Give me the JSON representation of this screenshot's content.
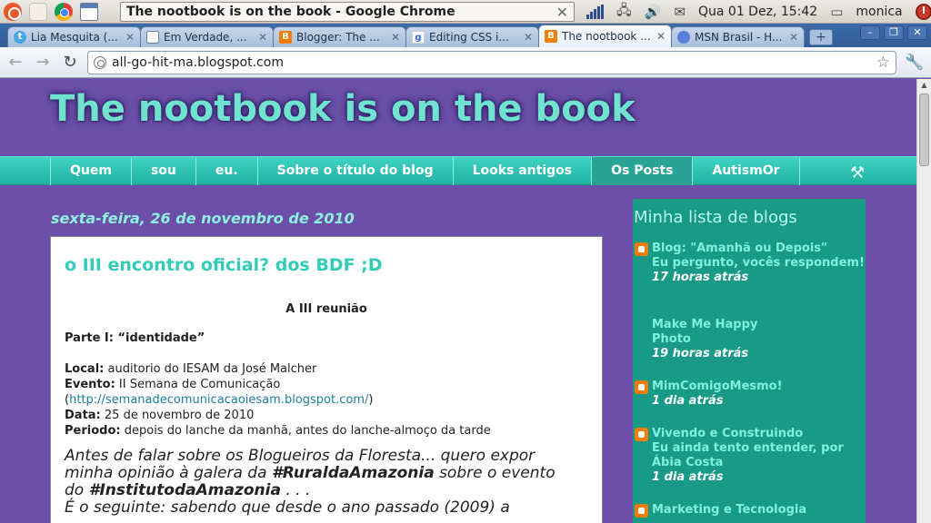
{
  "panel": {
    "window_title": "The nootbook is on the book - Google Chrome",
    "clock": "Qua 01 Dez, 15:42",
    "user": "monica"
  },
  "tabs": [
    {
      "label": "Lia Mesquita (...",
      "icon": "twitter-icon"
    },
    {
      "label": "Em Verdade, ...",
      "icon": "document-icon"
    },
    {
      "label": "Blogger: The ...",
      "icon": "blogger-icon"
    },
    {
      "label": "Editing CSS i...",
      "icon": "google-icon"
    },
    {
      "label": "The nootbook ...",
      "icon": "blogger-icon",
      "active": true
    },
    {
      "label": "MSN Brasil - H...",
      "icon": "msn-icon"
    }
  ],
  "toolbar": {
    "url": "all-go-hit-ma.blogspot.com"
  },
  "blog": {
    "title": "The nootbook is on the book",
    "nav": [
      "Quem",
      "sou",
      "eu.",
      "Sobre o título do blog",
      "Looks antigos",
      "Os Posts",
      "AutismOr"
    ],
    "current_nav": "Os Posts"
  },
  "post": {
    "date": "sexta-feira, 26 de novembro de 2010",
    "title": "o III encontro oficial? dos BDF ;D",
    "heading": "A III reunião",
    "part": "Parte I: “identidade”",
    "local_label": "Local:",
    "local_value": "auditorio do IESAM da José Malcher",
    "evento_label": "Evento:",
    "evento_value": "II Semana de Comunicação",
    "link_open": "(",
    "link": "http://semanadecomunicacaoiesam.blogspot.com/",
    "link_close": ")",
    "data_label": "Data:",
    "data_value": "25 de novembro de 2010",
    "periodo_label": "Periodo:",
    "periodo_value": "depois do lanche da manhã, antes do lanche-almoço da tarde",
    "body_line1": "Antes de falar sobre os Blogueiros da Floresta... quero expor",
    "body_line2_pre": "minha opinião à galera da ",
    "body_line2_tag": "#RuraldaAmazonia",
    "body_line2_post": " sobre o evento",
    "body_line3_pre": "do ",
    "body_line3_tag": "#InstitutodaAmazonia",
    "body_line3_post": " . . .",
    "body_line4": "É o seguinte: sabendo que desde o ano passado (2009) a"
  },
  "sidebar": {
    "title": "Minha lista de blogs",
    "blogs": [
      {
        "name": "Blog: \"Amanhã ou Depois\"",
        "post": "Eu pergunto, vocês respondem!",
        "time": "17 horas atrás",
        "has_icon": true
      },
      {
        "name": "Make Me Happy",
        "post": "Photo",
        "time": "19 horas atrás",
        "has_icon": false
      },
      {
        "name": "MimComigoMesmo!",
        "post": "",
        "time": "1 dia atrás",
        "has_icon": true
      },
      {
        "name": "Vivendo e Construindo",
        "post": "Eu ainda tento entender, por Ábia Costa",
        "time": "1 dia atrás",
        "has_icon": true
      },
      {
        "name": "Marketing e Tecnologia",
        "post": "",
        "time": "",
        "has_icon": true
      }
    ]
  }
}
